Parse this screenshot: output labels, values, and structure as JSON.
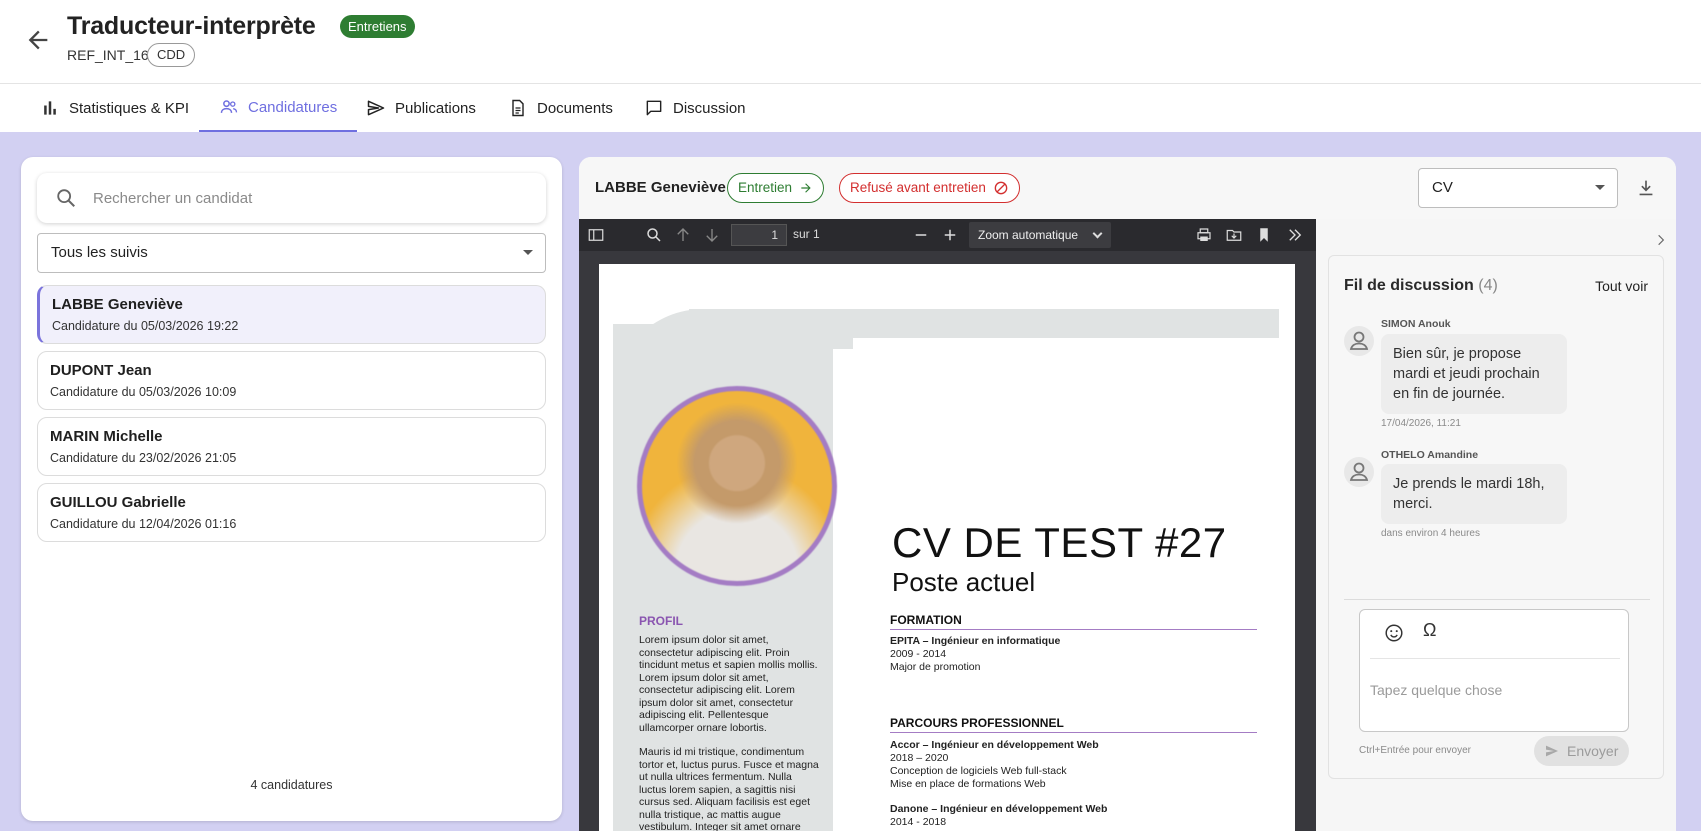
{
  "header": {
    "title": "Traducteur-interprète",
    "status_badge": "Entretiens",
    "reference": "REF_INT_16",
    "contract_type": "CDD"
  },
  "tabs": [
    {
      "label": "Statistiques & KPI",
      "icon": "bar-chart-icon"
    },
    {
      "label": "Candidatures",
      "icon": "people-icon",
      "active": true
    },
    {
      "label": "Publications",
      "icon": "send-icon"
    },
    {
      "label": "Documents",
      "icon": "document-icon"
    },
    {
      "label": "Discussion",
      "icon": "chat-icon"
    }
  ],
  "candidates_panel": {
    "search_placeholder": "Rechercher un candidat",
    "filter_value": "Tous les suivis",
    "candidates": [
      {
        "name": "LABBE Geneviève",
        "applied": "Candidature du 05/03/2026 19:22",
        "selected": true
      },
      {
        "name": "DUPONT Jean",
        "applied": "Candidature du 05/03/2026 10:09"
      },
      {
        "name": "MARIN Michelle",
        "applied": "Candidature du 23/02/2026 21:05"
      },
      {
        "name": "GUILLOU Gabrielle",
        "applied": "Candidature du 12/04/2026 01:16"
      }
    ],
    "count_label": "4 candidatures"
  },
  "detail": {
    "candidate_name": "LABBE Geneviève",
    "action_primary": "Entretien",
    "action_reject": "Refusé avant entretien",
    "document_select": "CV"
  },
  "pdf_viewer": {
    "page_current": "1",
    "page_total": "sur 1",
    "zoom": "Zoom automatique"
  },
  "cv": {
    "name": "CV DE TEST #27",
    "subtitle": "Poste actuel",
    "profil_title": "PROFIL",
    "profil_text_1": "Lorem ipsum dolor sit amet, consectetur adipiscing elit. Proin tincidunt metus et sapien mollis mollis. Lorem ipsum dolor sit amet, consectetur adipiscing elit. Lorem ipsum dolor sit amet, consectetur adipiscing elit. Pellentesque ullamcorper ornare lobortis.",
    "profil_text_2": "Mauris id mi tristique, condimentum tortor et, luctus purus. Fusce et magna ut nulla ultrices fermentum. Nulla luctus lorem sapien, a sagittis nisi cursus sed. Aliquam facilisis est eget nulla tristique, ac mattis augue vestibulum. Integer sit amet ornare",
    "formation_title": "FORMATION",
    "formation_lines": [
      "EPITA – Ingénieur en informatique",
      "2009 - 2014",
      "Major de promotion"
    ],
    "parcours_title": "PARCOURS PROFESSIONNEL",
    "parcours_lines": [
      "Accor – Ingénieur en développement Web",
      "2018 – 2020",
      "Conception de logiciels Web full-stack",
      "Mise en place de formations Web",
      "Danone – Ingénieur en développement Web",
      "2014 - 2018"
    ]
  },
  "discussion": {
    "title": "Fil de discussion",
    "count": "(4)",
    "see_all": "Tout voir",
    "messages": [
      {
        "author": "SIMON Anouk",
        "text": "Bien sûr, je propose mardi et jeudi prochain en fin de journée.",
        "time": "17/04/2026, 11:21"
      },
      {
        "author": "OTHELO Amandine",
        "text": "Je prends le mardi 18h, merci.",
        "time": "dans environ 4 heures"
      }
    ],
    "compose_placeholder": "Tapez quelque chose",
    "omega": "Ω",
    "hint": "Ctrl+Entrée pour envoyer",
    "send_label": "Envoyer"
  },
  "colors": {
    "accent": "#6f6fe0",
    "success": "#2e7d32",
    "danger": "#d32f2f",
    "page_background": "#d2d0f2"
  }
}
